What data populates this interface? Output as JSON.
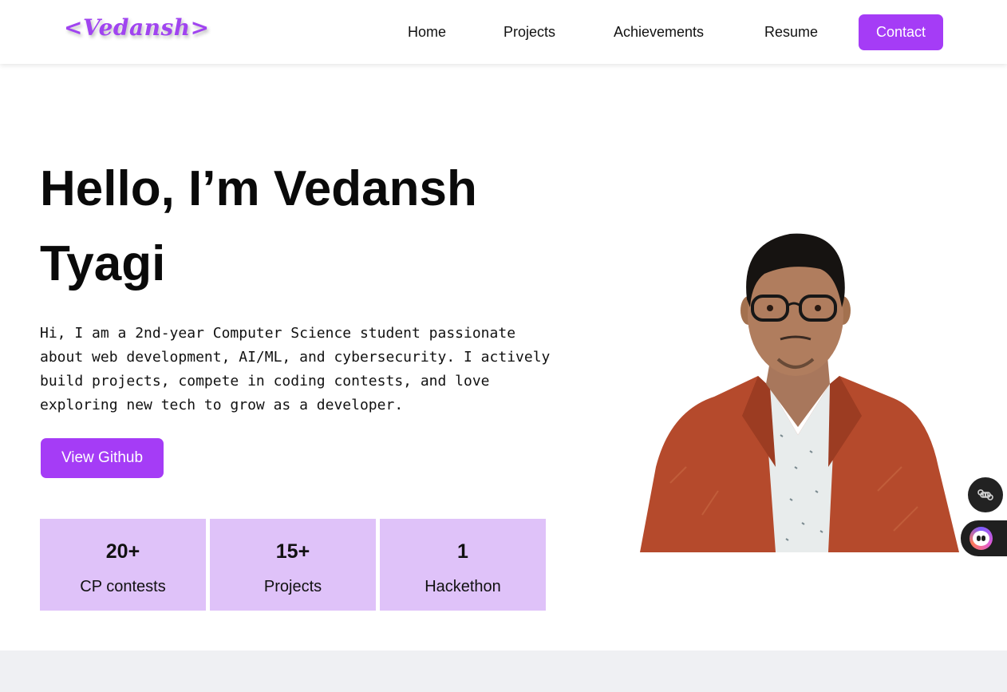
{
  "header": {
    "logo": "<Vedansh>",
    "nav": {
      "home": "Home",
      "projects": "Projects",
      "achievements": "Achievements",
      "resume": "Resume",
      "contact": "Contact"
    }
  },
  "hero": {
    "title_line1": "Hello, I’m Vedansh",
    "title_line2": "Tyagi",
    "description": "Hi, I am a 2nd-year Computer Science student passionate about web development, AI/ML, and cybersecurity. I actively build projects, compete in coding contests, and love exploring new tech to grow as a developer.",
    "github_button": "View Github"
  },
  "stats": [
    {
      "value": "20+",
      "label": "CP contests"
    },
    {
      "value": "15+",
      "label": "Projects"
    },
    {
      "value": "1",
      "label": "Hackethon"
    }
  ],
  "floating_widgets": {
    "command_icon": "command-icon",
    "assistant_icon": "assistant-bot-icon"
  },
  "colors": {
    "accent": "#a53cf6",
    "logo": "#a044f0",
    "stat_background": "#dfc2f9",
    "jacket": "#b54a2c",
    "section_band": "#eff0f3"
  }
}
